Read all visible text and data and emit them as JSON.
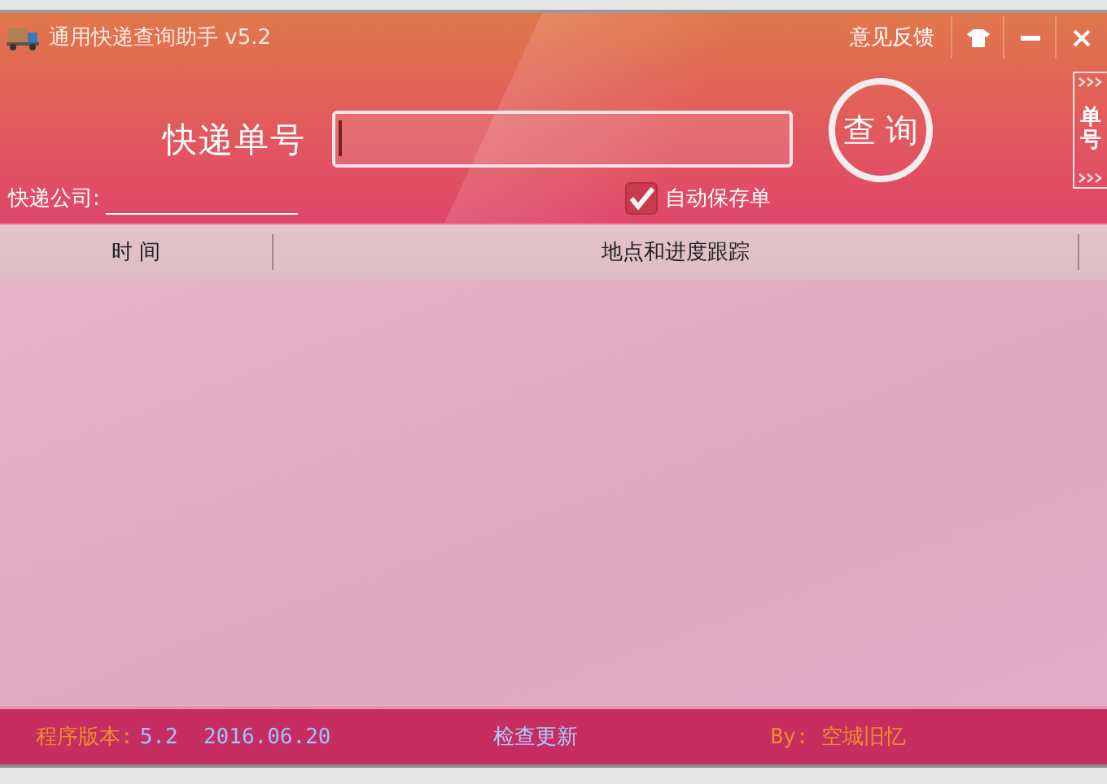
{
  "window": {
    "title": "通用快递查询助手 v5.2"
  },
  "title_bar": {
    "feedback": "意见反馈"
  },
  "search": {
    "label": "快递单号",
    "button": "查 询"
  },
  "company": {
    "label": "快递公司:"
  },
  "auto_save": {
    "label": "自动保存单",
    "checked": true
  },
  "side_tab": {
    "label": "单号"
  },
  "table": {
    "columns": [
      "时 间",
      "地点和进度跟踪"
    ]
  },
  "status_bar": {
    "version_label": "程序版本:",
    "version": "5.2  2016.06.20",
    "update_link": "检查更新",
    "author": "By: 空城旧忆"
  }
}
